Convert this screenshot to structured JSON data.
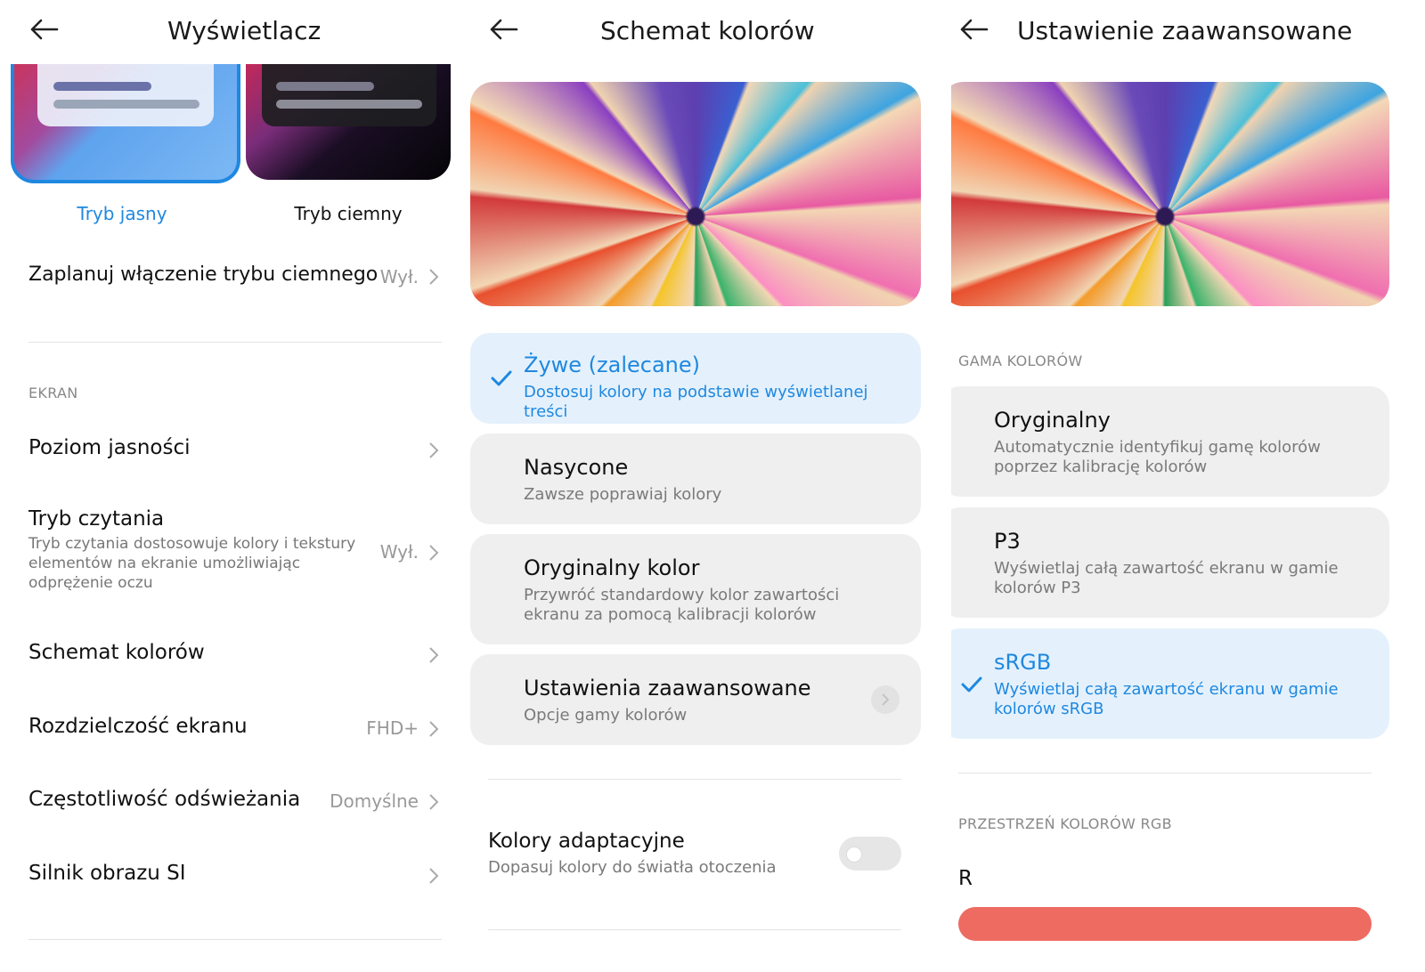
{
  "screen1": {
    "title": "Wyświetlacz",
    "theme_light_label": "Tryb jasny",
    "theme_dark_label": "Tryb ciemny",
    "schedule": {
      "label": "Zaplanuj włączenie trybu ciemnego",
      "value": "Wył."
    },
    "section_label": "EKRAN",
    "items": [
      {
        "label": "Poziom jasności",
        "value": ""
      },
      {
        "label": "Tryb czytania",
        "value": "Wył.",
        "sub": "Tryb czytania dostosowuje kolory i tekstury elementów na ekranie umożliwiając odprężenie oczu"
      },
      {
        "label": "Schemat kolorów",
        "value": ""
      },
      {
        "label": "Rozdzielczość ekranu",
        "value": "FHD+"
      },
      {
        "label": "Częstotliwość odświeżania",
        "value": "Domyślne"
      },
      {
        "label": "Silnik obrazu SI",
        "value": ""
      }
    ]
  },
  "screen2": {
    "title": "Schemat kolorów",
    "options": [
      {
        "title": "Żywe (zalecane)",
        "sub": "Dostosuj kolory na podstawie wyświetlanej treści",
        "selected": true
      },
      {
        "title": "Nasycone",
        "sub": "Zawsze poprawiaj kolory",
        "selected": false
      },
      {
        "title": "Oryginalny kolor",
        "sub": "Przywróć standardowy kolor zawartości ekranu za pomocą kalibracji kolorów",
        "selected": false
      },
      {
        "title": "Ustawienia zaawansowane",
        "sub": "Opcje gamy kolorów",
        "selected": false
      }
    ],
    "adaptive": {
      "title": "Kolory adaptacyjne",
      "sub": "Dopasuj kolory do światła otoczenia",
      "enabled": false
    }
  },
  "screen3": {
    "title": "Ustawienie zaawansowane",
    "gamut_label": "GAMA KOLORÓW",
    "options": [
      {
        "title": "Oryginalny",
        "sub": "Automatycznie identyfikuj gamę kolorów poprzez kalibrację kolorów",
        "selected": false
      },
      {
        "title": "P3",
        "sub": "Wyświetlaj całą zawartość ekranu w gamie kolorów P3",
        "selected": false
      },
      {
        "title": "sRGB",
        "sub": "Wyświetlaj całą zawartość ekranu w gamie kolorów sRGB",
        "selected": true
      }
    ],
    "rgb_label": "PRZESTRZEŃ KOLORÓW RGB",
    "r_label": "R"
  },
  "colors": {
    "accent": "#1f88e0",
    "selected_bg": "#e4f1fc",
    "slider_red": "#ee6b61"
  },
  "icons": [
    "back-arrow-icon",
    "chevron-right-icon",
    "checkmark-icon"
  ]
}
